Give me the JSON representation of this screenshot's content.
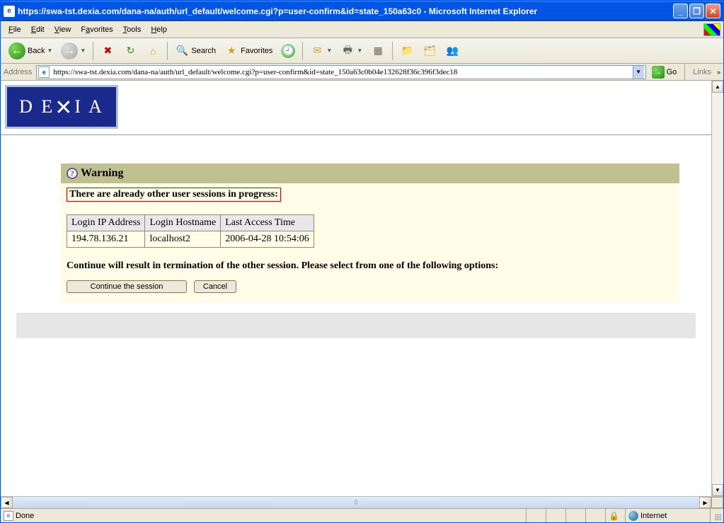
{
  "titlebar": {
    "text": "https://swa-tst.dexia.com/dana-na/auth/url_default/welcome.cgi?p=user-confirm&id=state_150a63c0 - Microsoft Internet Explorer"
  },
  "menu": {
    "file": "File",
    "edit": "Edit",
    "view": "View",
    "favorites": "Favorites",
    "tools": "Tools",
    "help": "Help"
  },
  "toolbar": {
    "back": "Back",
    "search": "Search",
    "favorites": "Favorites"
  },
  "address": {
    "label": "Address",
    "value": "https://swa-tst.dexia.com/dana-na/auth/url_default/welcome.cgi?p=user-confirm&id=state_150a63c0b04e132628f36c396f3dec18",
    "go": "Go",
    "links": "Links"
  },
  "logo": "DEXIA",
  "warning": {
    "title": "Warning",
    "message": "There are already other user sessions in progress:",
    "columns": [
      "Login IP Address",
      "Login Hostname",
      "Last Access Time"
    ],
    "rows": [
      {
        "ip": "194.78.136.21",
        "host": "localhost2",
        "time": "2006-04-28 10:54:06"
      }
    ],
    "instruction": "Continue will result in termination of the other session. Please select from one of the following options:",
    "continue_btn": "Continue the session",
    "cancel_btn": "Cancel"
  },
  "status": {
    "text": "Done",
    "zone": "Internet"
  }
}
